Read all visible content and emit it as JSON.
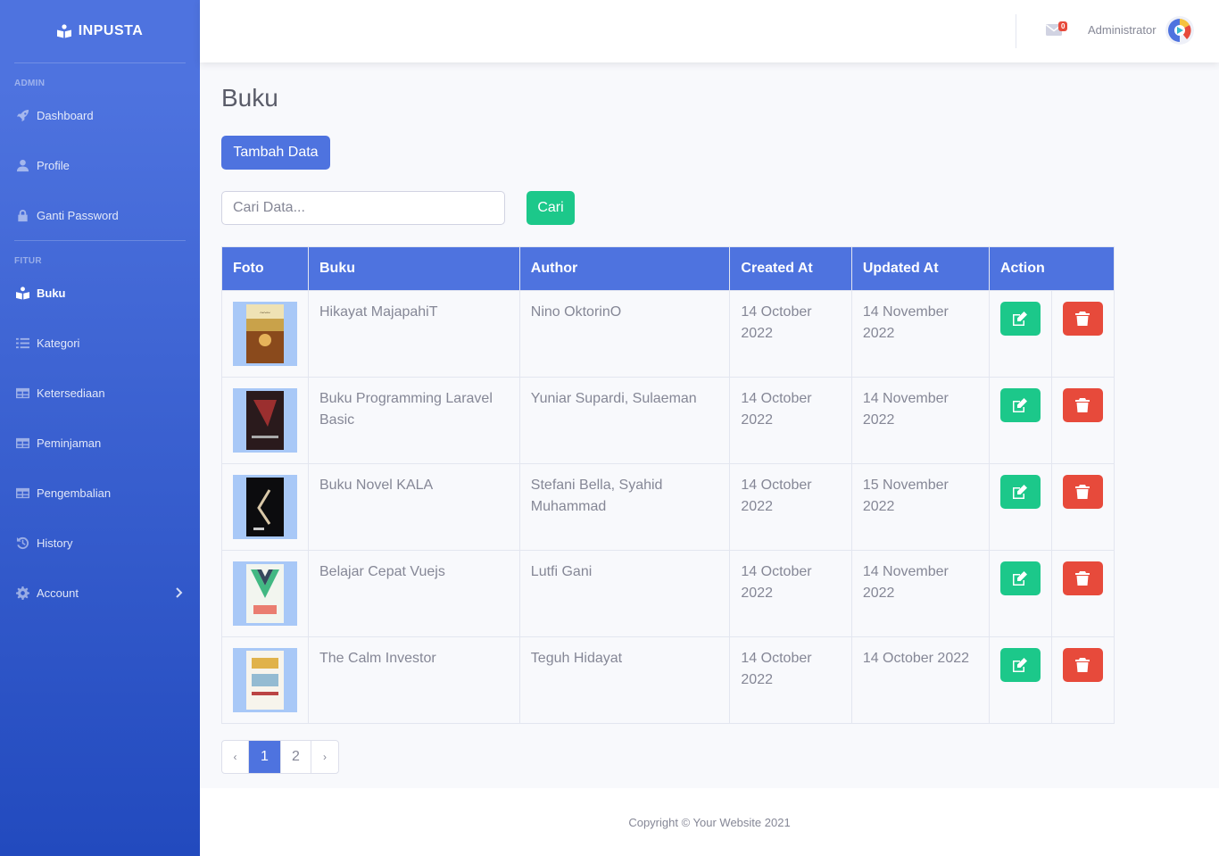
{
  "brand": {
    "name": "INPUSTA"
  },
  "sidebar": {
    "heading_admin": "ADMIN",
    "heading_fitur": "FITUR",
    "admin_items": [
      {
        "label": "Dashboard",
        "icon": "rocket-icon"
      },
      {
        "label": "Profile",
        "icon": "user-icon"
      },
      {
        "label": "Ganti Password",
        "icon": "lock-icon"
      }
    ],
    "fitur_items": [
      {
        "label": "Buku",
        "icon": "book-reader-icon",
        "active": true
      },
      {
        "label": "Kategori",
        "icon": "list-icon"
      },
      {
        "label": "Ketersediaan",
        "icon": "table-icon"
      },
      {
        "label": "Peminjaman",
        "icon": "table-icon"
      },
      {
        "label": "Pengembalian",
        "icon": "table-icon"
      },
      {
        "label": "History",
        "icon": "history-icon"
      },
      {
        "label": "Account",
        "icon": "cog-icon"
      }
    ]
  },
  "topbar": {
    "message_count": "0",
    "user_name": "Administrator"
  },
  "page": {
    "title": "Buku",
    "add_button": "Tambah Data",
    "search_placeholder": "Cari Data...",
    "search_button": "Cari"
  },
  "table": {
    "headers": [
      "Foto",
      "Buku",
      "Author",
      "Created At",
      "Updated At",
      "Action"
    ],
    "rows": [
      {
        "buku": "Hikayat MajapahiT",
        "author": "Nino OktorinO",
        "created": "14 October 2022",
        "updated": "14 November 2022"
      },
      {
        "buku": "Buku Programming Laravel Basic",
        "author": "Yuniar Supardi, Sulaeman",
        "created": "14 October 2022",
        "updated": "14 November 2022"
      },
      {
        "buku": "Buku Novel KALA",
        "author": "Stefani Bella, Syahid Muhammad",
        "created": "14 October 2022",
        "updated": "15 November 2022"
      },
      {
        "buku": "Belajar Cepat Vuejs",
        "author": "Lutfi Gani",
        "created": "14 October 2022",
        "updated": "14 November 2022"
      },
      {
        "buku": "The Calm Investor",
        "author": "Teguh Hidayat",
        "created": "14 October 2022",
        "updated": "14 October 2022"
      }
    ]
  },
  "pagination": {
    "prev": "‹",
    "pages": [
      "1",
      "2"
    ],
    "next": "›",
    "active": "1"
  },
  "footer": {
    "text": "Copyright © Your Website 2021"
  },
  "colors": {
    "primary": "#4e73df",
    "success": "#1cc88a",
    "danger": "#e74a3b"
  }
}
